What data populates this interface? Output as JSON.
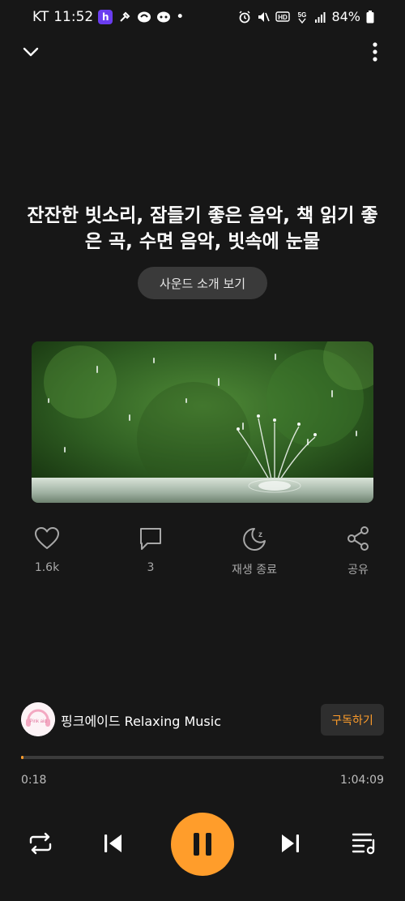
{
  "status_bar": {
    "carrier": "KT",
    "time": "11:52",
    "app_badge": "h",
    "battery": "84%",
    "network": "5G"
  },
  "player": {
    "title": "잔잔한 빗소리, 잠들기 좋은 음악, 책 읽기 좋은 곡, 수면 음악, 빗속에 눈물",
    "intro_button": "사운드 소개 보기",
    "artwork_icon": "rain-splash-image"
  },
  "actions": {
    "like_count": "1.6k",
    "comment_count": "3",
    "sleep_timer_label": "재생 종료",
    "share_label": "공유"
  },
  "channel": {
    "name": "핑크에이드 Relaxing Music",
    "subscribe_label": "구독하기",
    "avatar_text": "Pink aid"
  },
  "playback": {
    "current_time": "0:18",
    "total_time": "1:04:09",
    "progress": 0.0047,
    "state": "playing"
  },
  "colors": {
    "accent": "#ff9d2b",
    "background": "#171717"
  }
}
